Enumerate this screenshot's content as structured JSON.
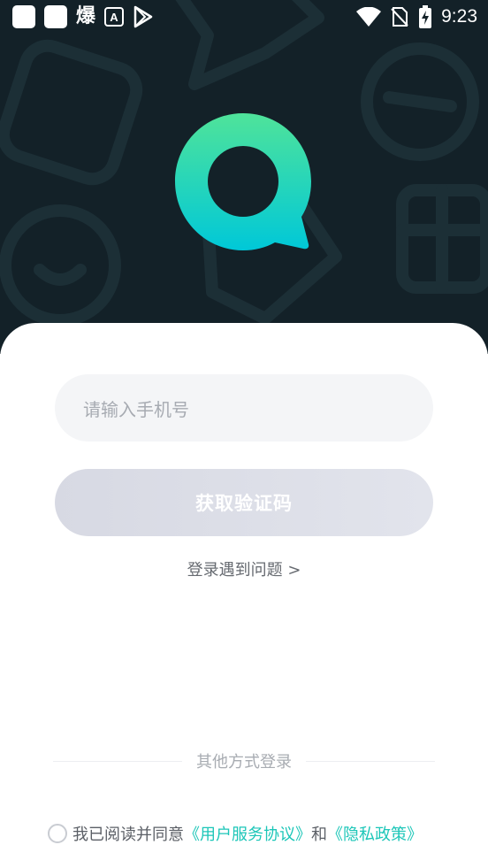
{
  "status_bar": {
    "notification_text": "爆",
    "time": "9:23"
  },
  "login": {
    "phone_placeholder": "请输入手机号",
    "get_code_label": "获取验证码",
    "help_link": "登录遇到问题 >",
    "other_methods_label": "其他方式登录",
    "agreement": {
      "prefix": "我已阅读并同意",
      "user_agreement": "《用户服务协议》",
      "conjunction": "和",
      "privacy_policy": "《隐私政策》"
    }
  },
  "colors": {
    "hero_background": "#132128",
    "accent": "#1cc6b8",
    "logo_gradient_start": "#4fe39a",
    "logo_gradient_end": "#00c8d8"
  },
  "icons": [
    "app-icon",
    "app-icon",
    "font-icon",
    "play-store-icon",
    "wifi-icon",
    "no-sim-icon",
    "battery-charging-icon",
    "logo-icon",
    "radio-icon"
  ]
}
